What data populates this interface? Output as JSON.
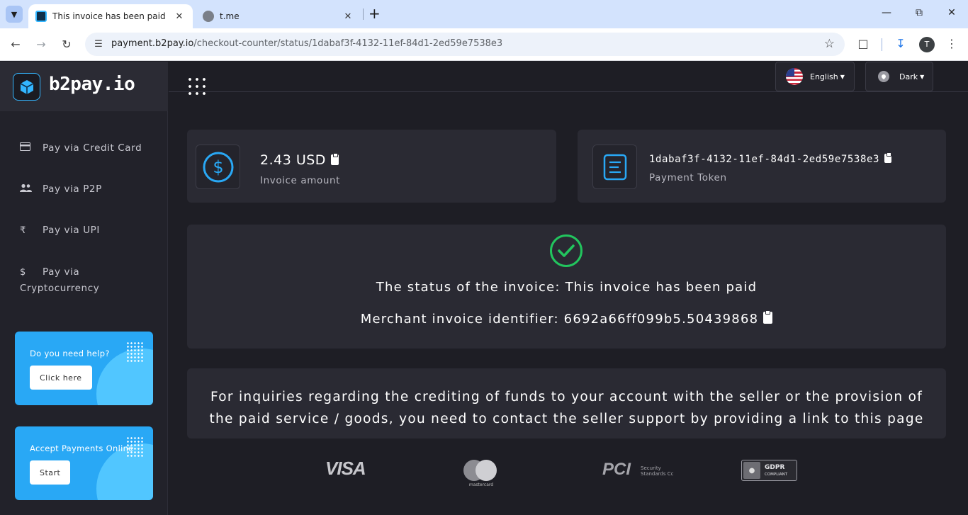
{
  "browser": {
    "tabs": [
      {
        "title": "This invoice has been paid",
        "active": true
      },
      {
        "title": "t.me",
        "active": false
      }
    ],
    "url_host": "payment.b2pay.io",
    "url_path": "/checkout-counter/status/1dabaf3f-4132-11ef-84d1-2ed59e7538e3",
    "profile_initial": "T",
    "icons": {
      "tab_search": "chevron-down-icon",
      "close": "close-icon",
      "new_tab": "plus-icon",
      "back": "arrow-left-icon",
      "forward": "arrow-right-icon",
      "reload": "reload-icon",
      "bookmark": "star-icon",
      "extensions": "puzzle-icon",
      "downloads": "download-icon",
      "menu": "kebab-menu-icon"
    }
  },
  "sidebar": {
    "brand": "b2pay.io",
    "items": [
      {
        "label": "Pay via Credit Card",
        "icon": "credit-card-icon"
      },
      {
        "label": "Pay via P2P",
        "icon": "people-icon"
      },
      {
        "label": "Pay via UPI",
        "icon": "rupee-icon"
      },
      {
        "label": "Pay via Cryptocurrency",
        "icon": "dollar-icon"
      }
    ],
    "promos": [
      {
        "title": "Do you need help?",
        "button": "Click here"
      },
      {
        "title": "Accept Payments Online",
        "button": "Start"
      }
    ]
  },
  "header": {
    "language": "English",
    "theme": "Dark"
  },
  "invoice": {
    "amount": "2.43 USD",
    "amount_label": "Invoice amount",
    "token": "1dabaf3f-4132-11ef-84d1-2ed59e7538e3",
    "token_label": "Payment Token",
    "status_text": "The status of the invoice: This invoice has been paid",
    "merchant_text": "Merchant invoice identifier: 6692a66ff099b5.50439868",
    "note": "For inquiries regarding the crediting of funds to your account with the seller or the provision of the paid service / goods, you need to contact the seller support by providing a link to this page"
  },
  "footer_logos": {
    "visa": "VISA",
    "mastercard": "mastercard",
    "pci": "PCI",
    "pci_sub_1": "Security",
    "pci_sub_2": "Standards Cc",
    "gdpr": "GDPR",
    "gdpr_sub": "COMPLIANT"
  },
  "colors": {
    "accent": "#29a8f5",
    "success": "#22c55e",
    "page_bg": "#1e1e25",
    "card_bg": "#2a2a33"
  }
}
